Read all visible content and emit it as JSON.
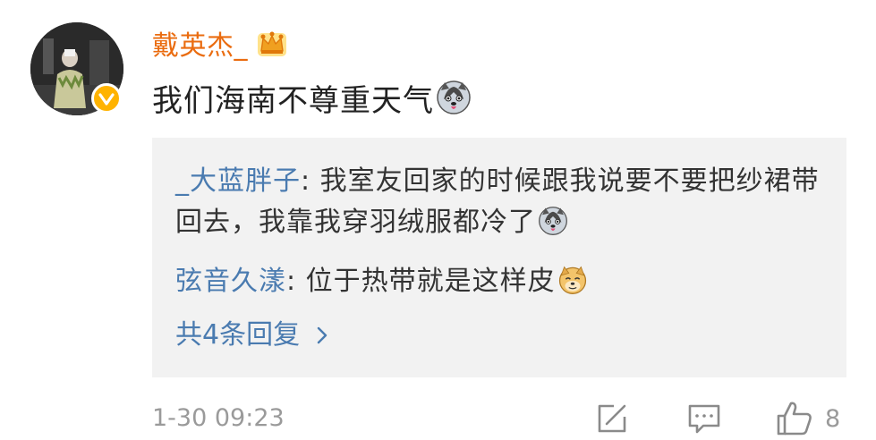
{
  "comment": {
    "username": "戴英杰_",
    "text": "我们海南不尊重天气",
    "timestamp": "1-30 09:23",
    "like_count": "8"
  },
  "replies": [
    {
      "name": "_大蓝胖子",
      "separator": ": ",
      "text": "我室友回家的时候跟我说要不要把纱裙带回去，我靠我穿羽绒服都冷了"
    },
    {
      "name": "弦音久漾",
      "separator": ": ",
      "text": "位于热带就是这样皮"
    }
  ],
  "more_replies_label": "共4条回复",
  "icons": {
    "verified": "verified-badge-icon",
    "crown": "vip-crown-icon",
    "emoji_husky": "husky-emoji-icon",
    "emoji_doge": "doge-emoji-icon",
    "share": "share-icon",
    "comment": "comment-icon",
    "like": "like-icon",
    "chevron": "chevron-right-icon"
  },
  "colors": {
    "username": "#ea6c10",
    "reply_name": "#4a7bb0",
    "reply_bg": "#f2f2f2",
    "meta": "#9a9a9a",
    "badge": "#ffb300"
  }
}
